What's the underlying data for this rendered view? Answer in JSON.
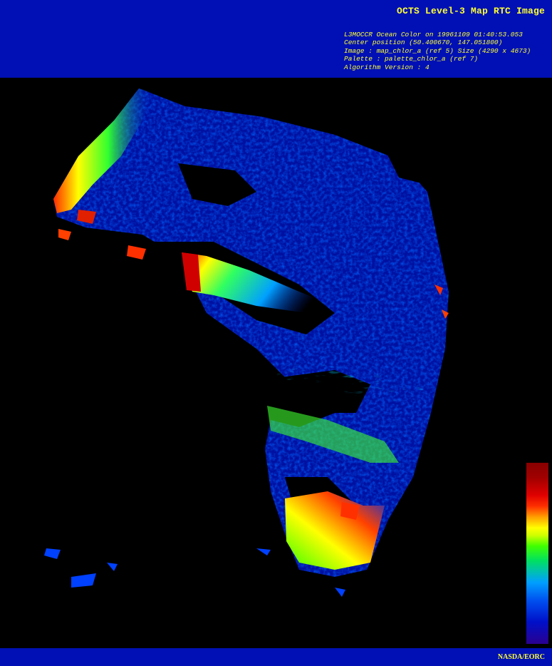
{
  "header": {
    "title": "OCTS Level-3 Map RTC Image",
    "meta_lines": [
      "L3MOCCR Ocean Color on 19961109 01:40:53.053",
      "Center position (50.400670, 147.051800)",
      "Image : map_chlor_a (ref 5) Size (4290 x 4673)",
      "Palette : palette_chlor_a (ref 7)",
      "Algorithm Version : 4"
    ]
  },
  "footer": {
    "credit": "NASDA/EORC"
  },
  "colors": {
    "banner": "#0010b4",
    "text": "#ffff33",
    "background": "#000000"
  },
  "colorbar": {
    "stops": [
      "#2a0090",
      "#0010c8",
      "#0050f0",
      "#00a0ff",
      "#00e060",
      "#40ff00",
      "#ffff00",
      "#ffa000",
      "#ff3000",
      "#e00000",
      "#880000"
    ]
  }
}
